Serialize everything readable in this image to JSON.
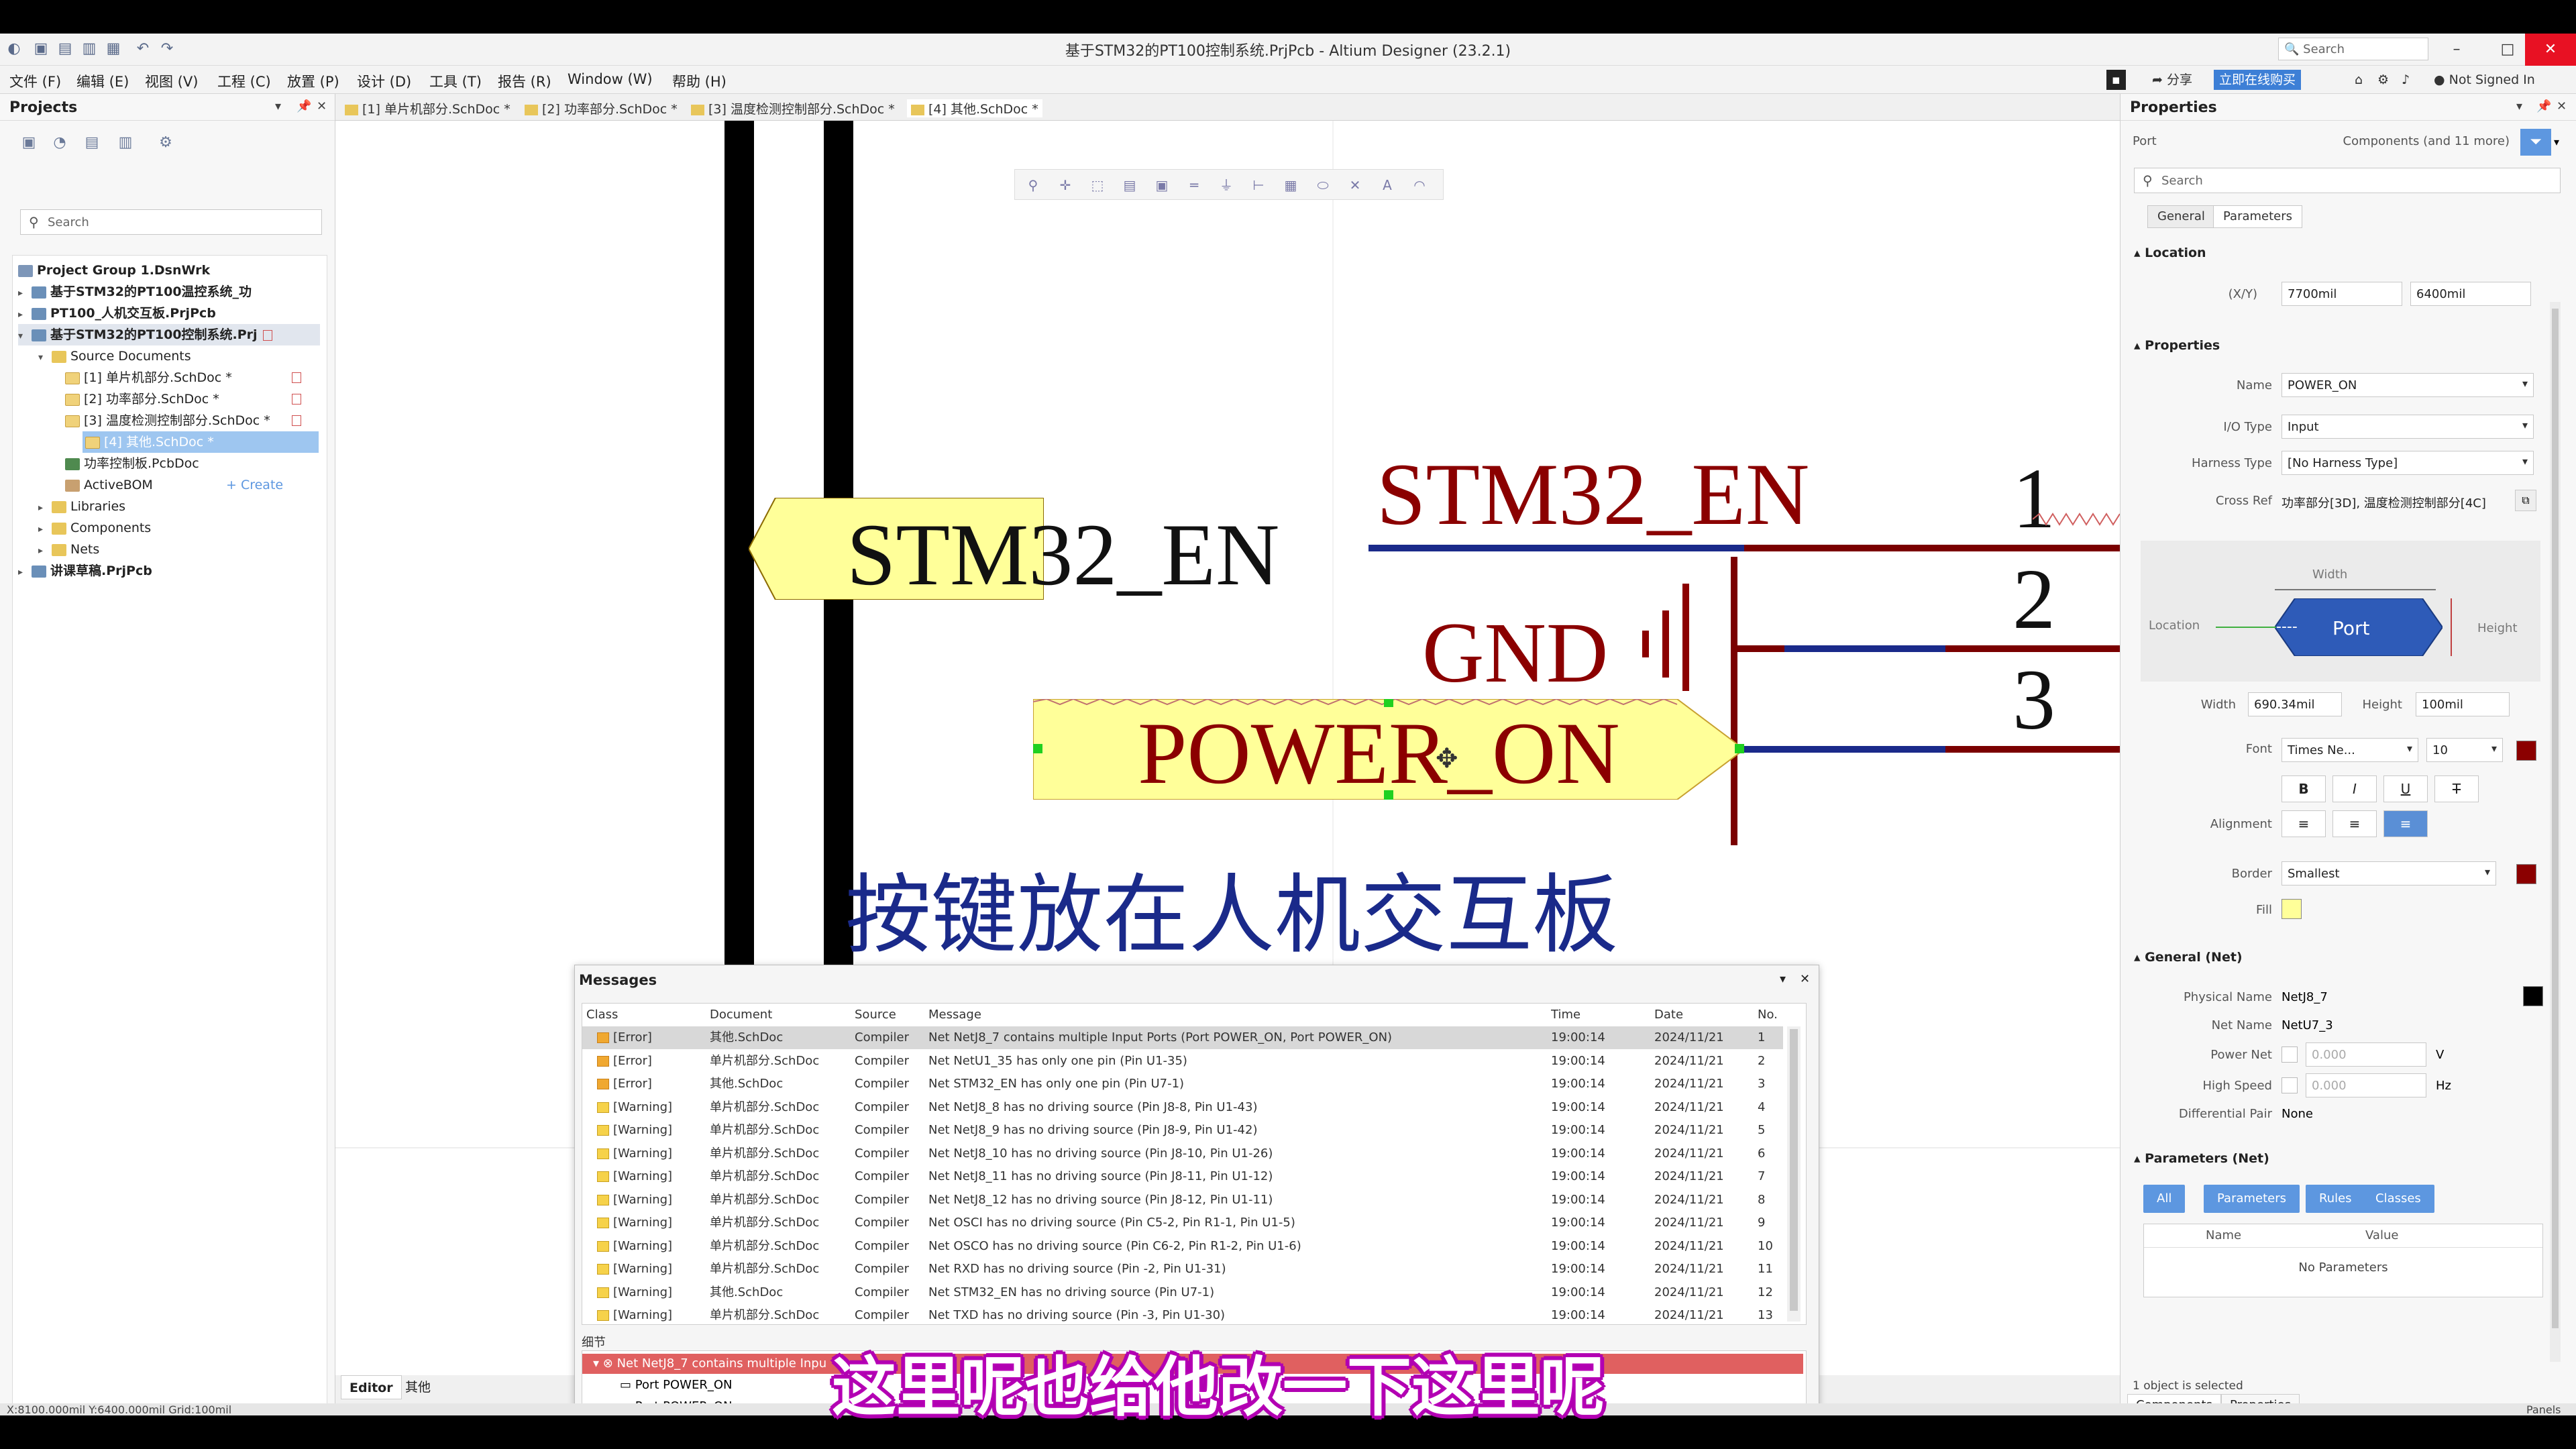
{
  "window": {
    "title": "基于STM32的PT100控制系统.PrjPcb - Altium Designer (23.2.1)",
    "search_placeholder": "Search",
    "min": "–",
    "max": "□",
    "close": "✕"
  },
  "menu": {
    "items": [
      "文件 (F)",
      "编辑 (E)",
      "视图 (V)",
      "工程 (C)",
      "放置 (P)",
      "设计 (D)",
      "工具 (T)",
      "报告 (R)",
      "Window (W)",
      "帮助 (H)"
    ],
    "share": "分享",
    "buy": "立即在线购买",
    "signin": "Not Signed In"
  },
  "projects": {
    "title": "Projects",
    "search_placeholder": "Search",
    "tree": {
      "group": "Project Group 1.DsnWrk",
      "proj1": "基于STM32的PT100温控系统_功",
      "proj2": "PT100_人机交互板.PrjPcb",
      "proj3": "基于STM32的PT100控制系统.Prj",
      "source_docs": "Source Documents",
      "doc1": "[1] 单片机部分.SchDoc *",
      "doc2": "[2] 功率部分.SchDoc *",
      "doc3": "[3] 温度检测控制部分.SchDoc *",
      "doc4": "[4] 其他.SchDoc *",
      "pcb": "功率控制板.PcbDoc",
      "bom": "ActiveBOM",
      "create": "+ Create",
      "libraries": "Libraries",
      "components": "Components",
      "nets": "Nets",
      "proj4": "讲课草稿.PrjPcb"
    },
    "bottom_tabs": [
      "Editor",
      "其他"
    ]
  },
  "doc_tabs": [
    "[1] 单片机部分.SchDoc *",
    "[2] 功率部分.SchDoc *",
    "[3] 温度检测控制部分.SchDoc *",
    "[4] 其他.SchDoc *"
  ],
  "schematic": {
    "port_left": "STM32_EN",
    "net_stm32": "STM32_EN",
    "gnd": "GND",
    "port_power": "POWER_ON",
    "pin1": "1",
    "pin2": "2",
    "pin3": "3",
    "note": "按键放在人机交互板"
  },
  "messages": {
    "title": "Messages",
    "columns": [
      "Class",
      "Document",
      "Source",
      "Message",
      "Time",
      "Date",
      "No."
    ],
    "rows": [
      {
        "cls": "[Error]",
        "doc": "其他.SchDoc",
        "src": "Compiler",
        "msg": "Net NetJ8_7 contains multiple Input Ports (Port POWER_ON, Port POWER_ON)",
        "time": "19:00:14",
        "date": "2024/11/21",
        "no": "1"
      },
      {
        "cls": "[Error]",
        "doc": "单片机部分.SchDoc",
        "src": "Compiler",
        "msg": "Net NetU1_35 has only one pin (Pin U1-35)",
        "time": "19:00:14",
        "date": "2024/11/21",
        "no": "2"
      },
      {
        "cls": "[Error]",
        "doc": "其他.SchDoc",
        "src": "Compiler",
        "msg": "Net STM32_EN has only one pin (Pin U7-1)",
        "time": "19:00:14",
        "date": "2024/11/21",
        "no": "3"
      },
      {
        "cls": "[Warning]",
        "doc": "单片机部分.SchDoc",
        "src": "Compiler",
        "msg": "Net NetJ8_8 has no driving source (Pin J8-8, Pin U1-43)",
        "time": "19:00:14",
        "date": "2024/11/21",
        "no": "4"
      },
      {
        "cls": "[Warning]",
        "doc": "单片机部分.SchDoc",
        "src": "Compiler",
        "msg": "Net NetJ8_9 has no driving source (Pin J8-9, Pin U1-42)",
        "time": "19:00:14",
        "date": "2024/11/21",
        "no": "5"
      },
      {
        "cls": "[Warning]",
        "doc": "单片机部分.SchDoc",
        "src": "Compiler",
        "msg": "Net NetJ8_10 has no driving source (Pin J8-10, Pin U1-26)",
        "time": "19:00:14",
        "date": "2024/11/21",
        "no": "6"
      },
      {
        "cls": "[Warning]",
        "doc": "单片机部分.SchDoc",
        "src": "Compiler",
        "msg": "Net NetJ8_11 has no driving source (Pin J8-11, Pin U1-12)",
        "time": "19:00:14",
        "date": "2024/11/21",
        "no": "7"
      },
      {
        "cls": "[Warning]",
        "doc": "单片机部分.SchDoc",
        "src": "Compiler",
        "msg": "Net NetJ8_12 has no driving source (Pin J8-12, Pin U1-11)",
        "time": "19:00:14",
        "date": "2024/11/21",
        "no": "8"
      },
      {
        "cls": "[Warning]",
        "doc": "单片机部分.SchDoc",
        "src": "Compiler",
        "msg": "Net OSCI has no driving source (Pin C5-2, Pin R1-1, Pin U1-5)",
        "time": "19:00:14",
        "date": "2024/11/21",
        "no": "9"
      },
      {
        "cls": "[Warning]",
        "doc": "单片机部分.SchDoc",
        "src": "Compiler",
        "msg": "Net OSCO has no driving source (Pin C6-2, Pin R1-2, Pin U1-6)",
        "time": "19:00:14",
        "date": "2024/11/21",
        "no": "10"
      },
      {
        "cls": "[Warning]",
        "doc": "单片机部分.SchDoc",
        "src": "Compiler",
        "msg": "Net RXD has no driving source (Pin -2, Pin U1-31)",
        "time": "19:00:14",
        "date": "2024/11/21",
        "no": "11"
      },
      {
        "cls": "[Warning]",
        "doc": "其他.SchDoc",
        "src": "Compiler",
        "msg": "Net STM32_EN has no driving source (Pin U7-1)",
        "time": "19:00:14",
        "date": "2024/11/21",
        "no": "12"
      },
      {
        "cls": "[Warning]",
        "doc": "单片机部分.SchDoc",
        "src": "Compiler",
        "msg": "Net TXD has no driving source (Pin -3, Pin U1-30)",
        "time": "19:00:14",
        "date": "2024/11/21",
        "no": "13"
      }
    ],
    "detail_label": "细节",
    "detail": {
      "root": "Net NetJ8_7 contains multiple Inpu",
      "child1": "Port POWER_ON",
      "child2": "Port POWER_ON"
    }
  },
  "properties": {
    "title": "Properties",
    "kind": "Port",
    "scope": "Components (and 11 more)",
    "search_placeholder": "Search",
    "tabs": [
      "General",
      "Parameters"
    ],
    "location_section": "Location",
    "xy_label": "(X/Y)",
    "x": "7700mil",
    "y": "6400mil",
    "properties_section": "Properties",
    "name_label": "Name",
    "name": "POWER_ON",
    "io_label": "I/O Type",
    "io": "Input",
    "harness_label": "Harness Type",
    "harness": "[No Harness Type]",
    "crossref_label": "Cross Ref",
    "crossref": "功率部分[3D], 温度检测控制部分[4C]",
    "diagram": {
      "width": "Width",
      "height": "Height",
      "location": "Location",
      "port": "Port"
    },
    "width_label": "Width",
    "width": "690.34mil",
    "height_label": "Height",
    "height": "100mil",
    "font_label": "Font",
    "font": "Times Ne...",
    "font_size": "10",
    "bold": "B",
    "italic": "I",
    "underline": "U",
    "strike": "T",
    "align_label": "Alignment",
    "border_label": "Border",
    "border": "Smallest",
    "fill_label": "Fill",
    "general_net_section": "General (Net)",
    "physical_label": "Physical Name",
    "physical": "NetJ8_7",
    "netname_label": "Net Name",
    "netname": "NetU7_3",
    "powernet_label": "Power Net",
    "powernet": "0.000",
    "powernet_unit": "V",
    "highspeed_label": "High Speed",
    "highspeed": "0.000",
    "highspeed_unit": "Hz",
    "diffpair_label": "Differential Pair",
    "diffpair": "None",
    "params_section": "Parameters (Net)",
    "param_buttons": [
      "All",
      "Parameters",
      "Rules",
      "Classes"
    ],
    "param_cols": [
      "Name",
      "Value"
    ],
    "no_params": "No Parameters",
    "selected": "1 object is selected",
    "bottom_tabs": [
      "Components",
      "Properties"
    ]
  },
  "status": {
    "coords": "X:8100.000mil Y:6400.000mil   Grid:100mil",
    "panels": "Panels"
  },
  "subtitle": "这里呢也给他改一下这里呢",
  "colors": {
    "port_fill": "#ffff99",
    "net_label": "#8b0000",
    "wire": "#1a2a8a",
    "accent": "#5d97e0",
    "subtitle_outline": "#b000b0"
  }
}
